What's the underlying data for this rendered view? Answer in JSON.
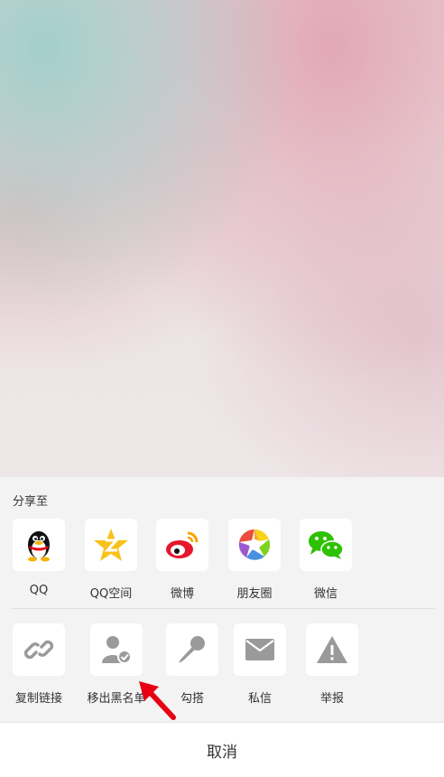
{
  "share_title": "分享至",
  "share_targets": [
    {
      "label": "QQ",
      "icon": "qq-penguin-icon"
    },
    {
      "label": "QQ空间",
      "icon": "qzone-star-icon"
    },
    {
      "label": "微博",
      "icon": "weibo-icon"
    },
    {
      "label": "朋友圈",
      "icon": "moments-aperture-icon"
    },
    {
      "label": "微信",
      "icon": "wechat-icon"
    }
  ],
  "actions": [
    {
      "label": "复制链接",
      "icon": "link-icon"
    },
    {
      "label": "移出黑名单",
      "icon": "user-check-icon"
    },
    {
      "label": "勾搭",
      "icon": "microphone-icon"
    },
    {
      "label": "私信",
      "icon": "mail-icon"
    },
    {
      "label": "举报",
      "icon": "warning-icon"
    }
  ],
  "cancel_label": "取消",
  "colors": {
    "sheet_bg": "#f3f3f3",
    "icon_gray": "#9a9a9a",
    "wechat_green": "#2dc100",
    "weibo_red": "#e6162d",
    "qzone_yellow": "#f7c21a",
    "arrow_red": "#e60012"
  }
}
